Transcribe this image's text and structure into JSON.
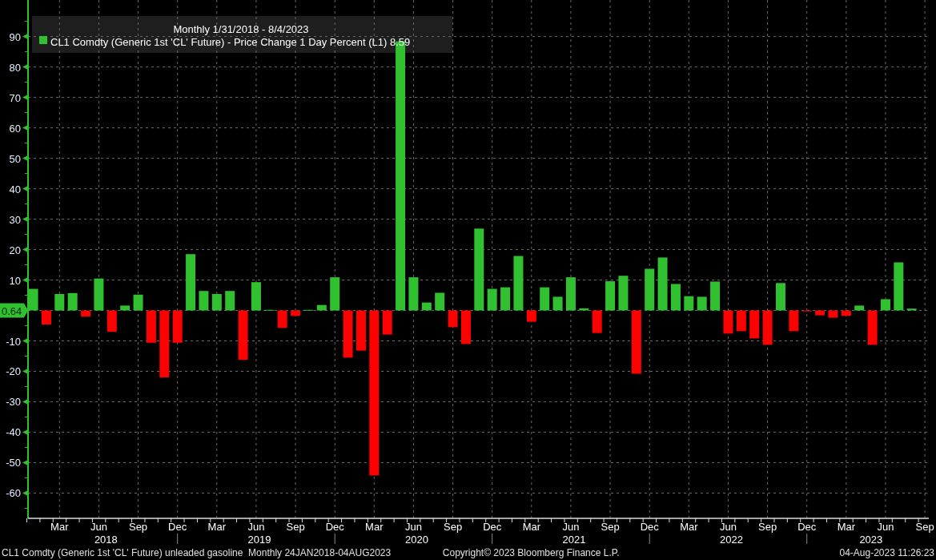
{
  "chart": {
    "last_value_label": "0.64",
    "legend_value": "8.59",
    "year_labels": [
      "2018",
      "2019",
      "2020",
      "2021",
      "2022",
      "2023"
    ],
    "chart_data": {
      "type": "bar",
      "title": "Monthly 1/31/2018 - 8/4/2023",
      "stacked": true,
      "grid": true,
      "categories": [
        null,
        null,
        "Mar",
        null,
        null,
        "Jun",
        null,
        null,
        "Sep",
        null,
        null,
        "Dec",
        null,
        null,
        "Mar",
        null,
        null,
        "Jun",
        null,
        null,
        "Sep",
        null,
        null,
        "Dec",
        null,
        null,
        "Mar",
        null,
        null,
        "Jun",
        null,
        null,
        "Sep",
        null,
        null,
        "Dec",
        null,
        null,
        "Mar",
        null,
        null,
        "Jun",
        null,
        null,
        "Sep",
        null,
        null,
        "Dec",
        null,
        null,
        "Mar",
        null,
        null,
        "Jun",
        null,
        null,
        "Sep",
        null,
        null,
        "Dec",
        null,
        null,
        "Mar",
        null,
        null,
        "Jun",
        null,
        null
      ],
      "series": [
        {
          "name": "CL1 Comdty (Generic 1st 'CL' Future) - Price Change 1 Day Percent (L1)",
          "color": "#30c030",
          "values": [
            7.1,
            null,
            5.4,
            5.7,
            null,
            10.5,
            null,
            1.6,
            5.2,
            null,
            null,
            null,
            18.5,
            6.4,
            5.4,
            6.4,
            null,
            9.3,
            0.2,
            null,
            null,
            0.2,
            1.8,
            10.9,
            null,
            null,
            null,
            null,
            88.4,
            10.9,
            2.6,
            5.8,
            null,
            null,
            26.9,
            7.1,
            7.6,
            17.9,
            null,
            7.6,
            4.5,
            10.9,
            0.7,
            null,
            9.6,
            11.4,
            null,
            13.7,
            17.4,
            8.7,
            4.7,
            4.5,
            9.5,
            null,
            null,
            null,
            null,
            9.0,
            null,
            null,
            null,
            null,
            null,
            1.6,
            null,
            3.7,
            15.8,
            0.6
          ]
        },
        {
          "color": "#ff0000",
          "values": [
            null,
            -4.6,
            null,
            null,
            -2.0,
            null,
            -7.0,
            null,
            null,
            -10.6,
            -22.0,
            -10.6,
            null,
            null,
            null,
            null,
            -16.2,
            null,
            null,
            -5.7,
            -1.8,
            null,
            null,
            null,
            -15.5,
            -13.2,
            -54.2,
            -7.9,
            null,
            null,
            null,
            null,
            -5.5,
            -11.0,
            null,
            null,
            null,
            null,
            -3.7,
            null,
            null,
            null,
            null,
            -7.4,
            null,
            null,
            -20.8,
            null,
            null,
            null,
            null,
            null,
            null,
            -7.6,
            -6.8,
            -9.2,
            -11.3,
            null,
            -6.8,
            -0.3,
            -1.6,
            -2.4,
            -1.8,
            null,
            -11.3,
            null,
            null,
            null
          ]
        }
      ],
      "ylim": [
        -68.3,
        102
      ],
      "yticks": [
        -60,
        -50,
        -40,
        -30,
        -20,
        -10,
        10,
        20,
        30,
        40,
        50,
        60,
        70,
        80,
        90
      ]
    },
    "after_last_label": "Sep"
  },
  "footer": {
    "description": "CL1 Comdty (Generic 1st 'CL' Future) unleaded gasoline  Monthly 24JAN2018-04AUG2023",
    "copyright": "Copyright© 2023 Bloomberg Finance L.P.",
    "timestamp": "04-Aug-2023 11:26:23"
  }
}
